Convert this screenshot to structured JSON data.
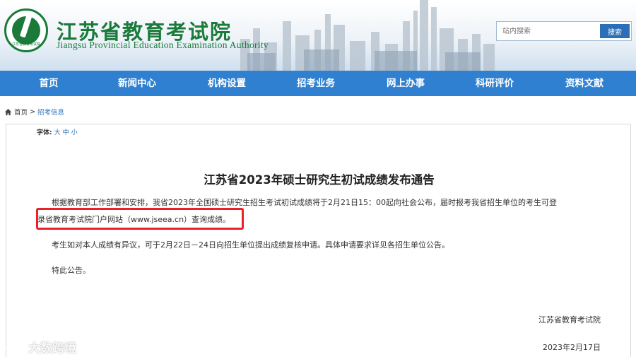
{
  "header": {
    "logo_text": "江苏省教育考试院",
    "title": "江苏省教育考试院",
    "subtitle": "Jiangsu Provincial Education Examination Authority",
    "search": {
      "placeholder": "站内搜索",
      "button_label": "搜索"
    }
  },
  "nav": {
    "items": [
      {
        "label": "首页"
      },
      {
        "label": "新闻中心"
      },
      {
        "label": "机构设置"
      },
      {
        "label": "招考业务"
      },
      {
        "label": "网上办事"
      },
      {
        "label": "科研评价"
      },
      {
        "label": "资料文献"
      }
    ]
  },
  "breadcrumb": {
    "home": "首页",
    "separator": ">",
    "current": "招考信息"
  },
  "article": {
    "font_size_label": "字体:",
    "font_sizes": [
      "大",
      "中",
      "小"
    ],
    "title": "江苏省2023年硕士研究生初试成绩发布通告",
    "para1_line1": "根据教育部工作部署和安排，我省2023年全国硕士研究生招生考试初试成绩将于2月21日15：00起向社会公布，届时报考我省招生单位的考生可登",
    "para1_line2": "录省教育考试院门户网站（www.jseea.cn）查询成绩。",
    "para2": "考生如对本人成绩有异议，可于2月22日－24日向招生单位提出成绩复核申请。具体申请要求详见各招生单位公告。",
    "para3": "特此公告。",
    "signature": "江苏省教育考试院",
    "date": "2023年2月17日"
  },
  "colors": {
    "brand_green": "#1a7a3a",
    "nav_blue": "#2f80d0",
    "highlight_red": "#e8212a"
  },
  "watermark": {
    "text": "大数跨境"
  }
}
